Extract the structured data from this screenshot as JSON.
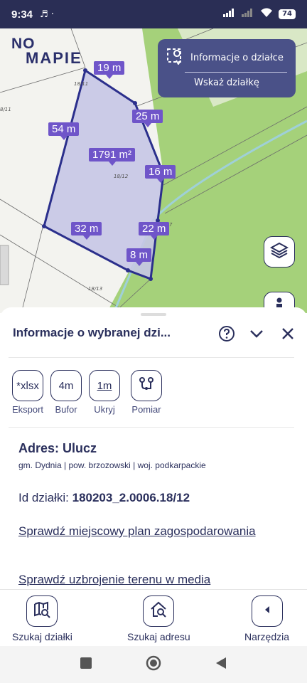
{
  "status_bar": {
    "time": "9:34",
    "battery": "74"
  },
  "logo": {
    "line1": "NO",
    "line2": "MAPIE"
  },
  "info_box": {
    "title": "Informacje o działce",
    "action": "Wskaż działkę"
  },
  "map": {
    "measurements": {
      "top": "19 m",
      "upper_right": "25 m",
      "left": "54 m",
      "area": "1791 m²",
      "right": "16 m",
      "bottom_left": "32 m",
      "lower_right": "22 m",
      "bottom_right": "8 m"
    },
    "plot_labels": {
      "n1": "18/11",
      "n2": "18/12",
      "n3": "18/13",
      "n4": "8/11",
      "n5": "7"
    },
    "colors": {
      "parcel_fill": "#c6c7e6",
      "parcel_border": "#2b2f8c",
      "label_bg": "#6f55c9",
      "green_area": "#a5d17a"
    }
  },
  "sheet": {
    "title": "Informacje o wybranej dzi...",
    "tools": [
      {
        "icon_text": "*xlsx",
        "label": "Eksport"
      },
      {
        "icon_text": "4m",
        "label": "Bufor"
      },
      {
        "icon_text": "1m",
        "label": "Ukryj"
      },
      {
        "icon_text": "",
        "label": "Pomiar"
      }
    ],
    "address_title": "Adres: Ulucz",
    "address_detail": "gm. Dydnia | pow. brzozowski | woj. podkarpackie",
    "plot_id_label": "Id działki:",
    "plot_id_value": "180203_2.0006.18/12",
    "link1": "Sprawdź miejscowy plan zagospodarowania",
    "link2": "Sprawdź uzbrojenie terenu w media"
  },
  "bottom_nav": {
    "search_plot": "Szukaj działki",
    "search_address": "Szukaj adresu",
    "tools": "Narzędzia"
  }
}
